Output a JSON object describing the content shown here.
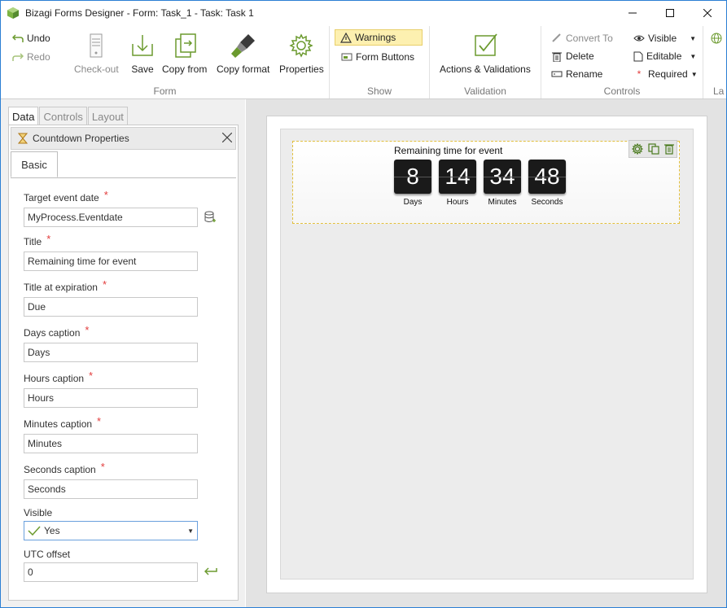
{
  "window": {
    "title": "Bizagi Forms Designer  - Form: Task_1 - Task:  Task 1"
  },
  "ribbon": {
    "undo": "Undo",
    "redo": "Redo",
    "checkout": "Check-out",
    "save": "Save",
    "copy_from": "Copy from",
    "copy_format": "Copy format",
    "properties": "Properties",
    "group_form": "Form",
    "warnings": "Warnings",
    "form_buttons": "Form Buttons",
    "group_show": "Show",
    "actions_validations": "Actions & Validations",
    "group_validation": "Validation",
    "convert_to": "Convert To",
    "delete": "Delete",
    "rename": "Rename",
    "visible": "Visible",
    "editable": "Editable",
    "required": "Required",
    "group_controls": "Controls",
    "group_lang": "La"
  },
  "left_tabs": [
    "Data",
    "Controls",
    "Layout"
  ],
  "properties_panel": {
    "title": "Countdown Properties",
    "subtab": "Basic",
    "fields": {
      "target_date_label": "Target event date",
      "target_date_value": "MyProcess.Eventdate",
      "title_label": "Title",
      "title_value": "Remaining time for event",
      "title_exp_label": "Title at expiration",
      "title_exp_value": "Due",
      "days_label": "Days caption",
      "days_value": "Days",
      "hours_label": "Hours caption",
      "hours_value": "Hours",
      "minutes_label": "Minutes caption",
      "minutes_value": "Minutes",
      "seconds_label": "Seconds caption",
      "seconds_value": "Seconds",
      "visible_label": "Visible",
      "visible_value": "Yes",
      "utc_label": "UTC offset",
      "utc_value": "0"
    }
  },
  "countdown": {
    "title": "Remaining time for event",
    "units": [
      {
        "value": "8",
        "caption": "Days"
      },
      {
        "value": "14",
        "caption": "Hours"
      },
      {
        "value": "34",
        "caption": "Minutes"
      },
      {
        "value": "48",
        "caption": "Seconds"
      }
    ]
  },
  "colors": {
    "accent_green": "#6b9a2e",
    "warning_bg": "#fdf0b0",
    "selection_dash": "#e2bf3d"
  }
}
